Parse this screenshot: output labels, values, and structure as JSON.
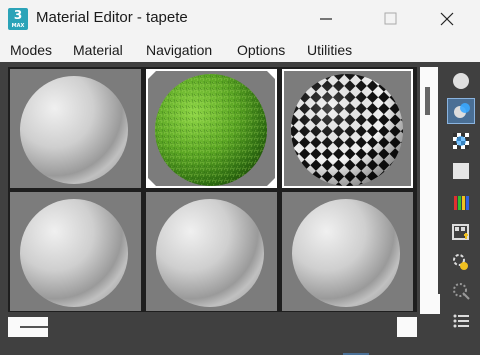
{
  "window": {
    "title": "Material Editor - tapete",
    "app_icon_label": "3",
    "app_icon_sub": "MAX"
  },
  "menu": [
    "Modes",
    "Material",
    "Navigation",
    "Options",
    "Utilities"
  ],
  "slots": [
    {
      "type": "gray-sphere"
    },
    {
      "type": "grass-sphere"
    },
    {
      "type": "checker-sphere"
    },
    {
      "type": "gray-sphere"
    },
    {
      "type": "gray-sphere"
    },
    {
      "type": "gray-sphere"
    }
  ],
  "side_tools": [
    "sample-type-sphere-icon",
    "backlight-icon",
    "background-checker-icon",
    "sample-uv-tiling-icon",
    "video-color-check-icon",
    "make-preview-icon",
    "options-icon",
    "select-by-material-icon",
    "material-map-navigator-icon"
  ],
  "colors": {
    "viewport_bg": "#404040",
    "slot_bg": "#7c7c7c",
    "accent": "#2ba3b8"
  }
}
